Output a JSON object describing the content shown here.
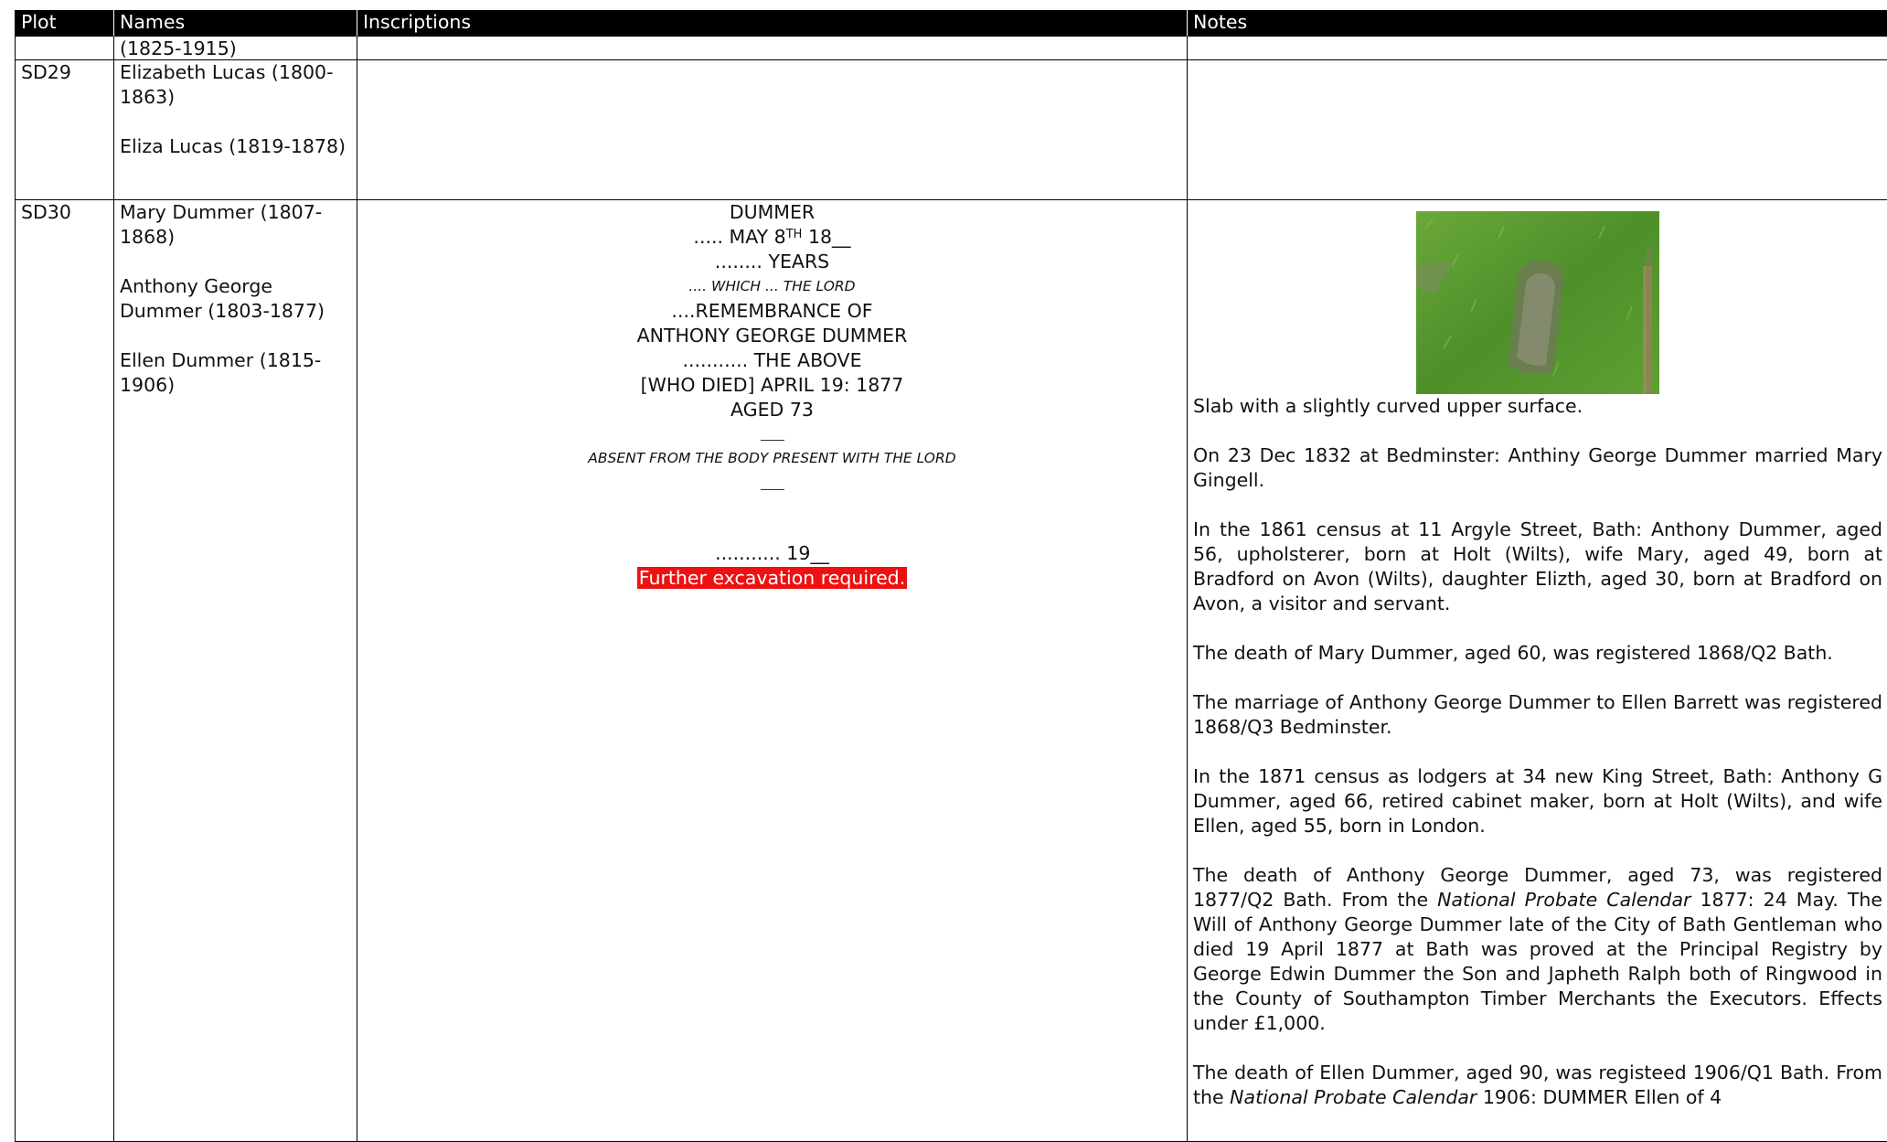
{
  "header": {
    "plot": "Plot",
    "names": "Names",
    "inscriptions": "Inscriptions",
    "notes": "Notes"
  },
  "rows": [
    {
      "plot": "",
      "names": [
        "(1825-1915)"
      ]
    },
    {
      "plot": "SD29",
      "names": [
        "Elizabeth Lucas (1800-1863)",
        "Eliza Lucas (1819-1878)"
      ]
    },
    {
      "plot": "SD30",
      "names": [
        "Mary Dummer (1807-1868)",
        "Anthony George Dummer (1803-1877)",
        "Ellen Dummer (1815-1906)"
      ],
      "inscription": {
        "l1": "DUMMER",
        "l2_pre": "..... MAY 8",
        "l2_sup": "TH",
        "l2_post": " 18__",
        "l3": "........ YEARS",
        "l4": "....  WHICH ...  THE LORD",
        "l5": "....REMEMBRANCE OF",
        "l6": "ANTHONY GEORGE DUMMER",
        "l7": "........... THE ABOVE",
        "l8": "[WHO DIED] APRIL 19: 1877",
        "l9": "AGED 73",
        "l10": "ABSENT FROM THE BODY PRESENT WITH THE LORD",
        "l11": "........... 19__",
        "note": "Further excavation required."
      },
      "notes": {
        "p1": "Slab with a slightly curved upper surface.",
        "p2": "On 23 Dec 1832 at Bedminster: Anthiny George Dummer married Mary Gingell.",
        "p3": "In the 1861 census at 11 Argyle Street, Bath: Anthony Dummer, aged 56, upholsterer, born at Holt (Wilts), wife Mary, aged 49, born at Bradford on Avon (Wilts), daughter Elizth, aged 30, born at Bradford on Avon, a visitor and servant.",
        "p4": "The death of Mary Dummer, aged 60, was registered 1868/Q2 Bath.",
        "p5": "The marriage of Anthony George Dummer to Ellen Barrett was registered 1868/Q3 Bedminster.",
        "p6": "In the 1871 census as lodgers at 34 new King Street, Bath: Anthony G Dummer, aged 66, retired cabinet maker, born at Holt (Wilts), and wife Ellen, aged 55, born in London.",
        "p7a": "The death of Anthony George Dummer, aged 73, was registered 1877/Q2 Bath. From the ",
        "p7i": "National Probate Calendar",
        "p7b": " 1877:  24 May. The Will of Anthony George Dummer late of the City of Bath Gentleman who died 19 April 1877 at Bath was proved at the Principal Registry by George Edwin Dummer the Son and Japheth Ralph both of Ringwood in the County of Southampton Timber Merchants the Executors. Effects under £1,000.",
        "p8a": "The death of Ellen Dummer, aged 90, was registeed 1906/Q1 Bath. From the ",
        "p8i": "National Probate Calendar",
        "p8b": " 1906: DUMMER Ellen of 4"
      }
    }
  ],
  "colors": {
    "header_bg": "#000000",
    "alert_bg": "#ee1111"
  }
}
